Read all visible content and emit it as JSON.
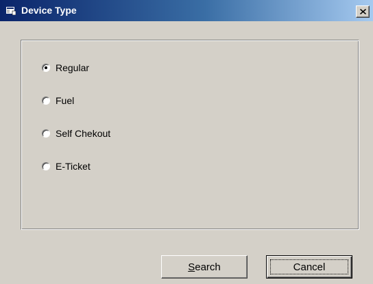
{
  "window": {
    "title": "Device Type",
    "close_glyph": "✕"
  },
  "device_group": {
    "options": [
      {
        "label": "Regular",
        "selected": true
      },
      {
        "label": "Fuel",
        "selected": false
      },
      {
        "label": "Self Chekout",
        "selected": false
      },
      {
        "label": "E-Ticket",
        "selected": false
      }
    ]
  },
  "buttons": {
    "search": {
      "accel": "S",
      "rest": "earch"
    },
    "cancel": {
      "label": "Cancel"
    }
  },
  "icons": {
    "title": "app-window-icon",
    "close": "close-icon"
  },
  "colors": {
    "titlebar_start": "#0a246a",
    "titlebar_end": "#a6caf0",
    "face": "#d4d0c8"
  }
}
